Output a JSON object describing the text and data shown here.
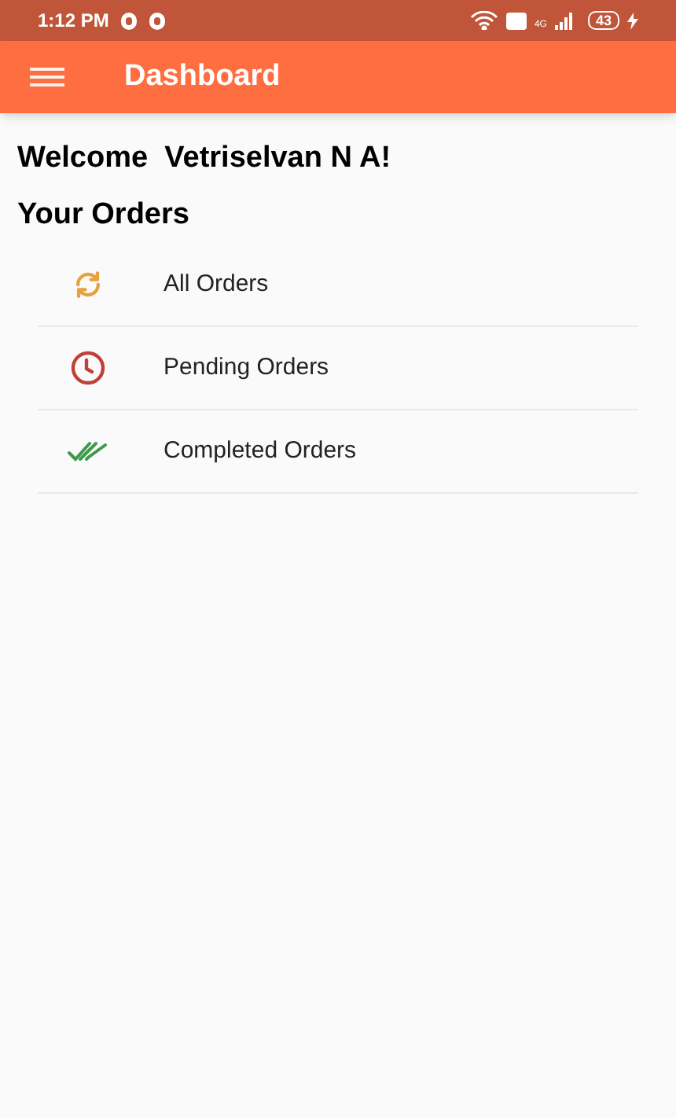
{
  "status_bar": {
    "time": "1:12 PM",
    "network": "4G",
    "battery": "43"
  },
  "app_bar": {
    "title": "Dashboard"
  },
  "welcome": "Welcome  Vetriselvan N A!",
  "section_title": "Your Orders",
  "orders_menu": [
    {
      "kind": "refresh",
      "label": "All Orders"
    },
    {
      "kind": "clock",
      "label": "Pending Orders"
    },
    {
      "kind": "done-all",
      "label": "Completed Orders"
    }
  ]
}
